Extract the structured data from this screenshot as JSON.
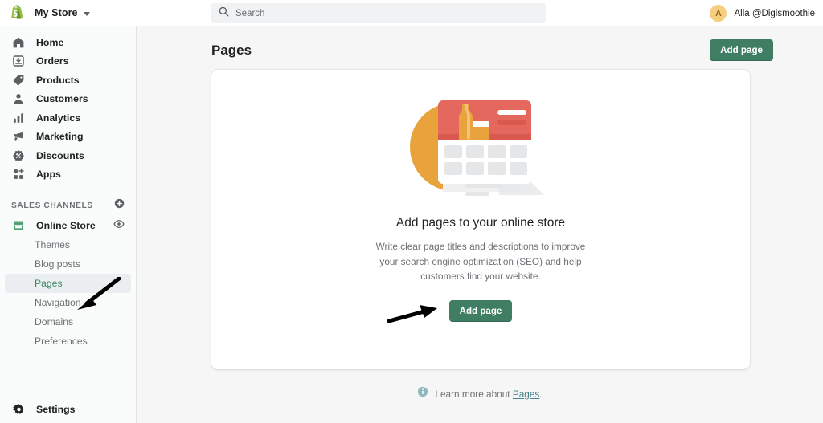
{
  "topbar": {
    "logo_icon": "shopify-bag-icon",
    "store_name": "My Store",
    "store_caret_icon": "chevron-down-icon",
    "search": {
      "icon": "search-icon",
      "placeholder": "Search",
      "value": ""
    },
    "user": {
      "avatar_initial": "A",
      "name": "Alla @Digismoothie",
      "avatar_color": "#f5ce7f"
    }
  },
  "sidebar": {
    "items": [
      {
        "label": "Home",
        "icon": "home-icon"
      },
      {
        "label": "Orders",
        "icon": "orders-inbox-icon"
      },
      {
        "label": "Products",
        "icon": "product-tag-icon"
      },
      {
        "label": "Customers",
        "icon": "customer-person-icon"
      },
      {
        "label": "Analytics",
        "icon": "analytics-bars-icon"
      },
      {
        "label": "Marketing",
        "icon": "marketing-megaphone-icon"
      },
      {
        "label": "Discounts",
        "icon": "discount-badge-icon"
      },
      {
        "label": "Apps",
        "icon": "apps-grid-plus-icon"
      }
    ],
    "sales_channels": {
      "title": "SALES CHANNELS",
      "add_icon": "plus-circle-icon",
      "channel": {
        "label": "Online Store",
        "icon": "storefront-icon",
        "icon_color": "#4a9c6d",
        "view_icon": "eye-icon"
      },
      "sub_items": [
        {
          "label": "Themes",
          "active": false
        },
        {
          "label": "Blog posts",
          "active": false
        },
        {
          "label": "Pages",
          "active": true
        },
        {
          "label": "Navigation",
          "active": false
        },
        {
          "label": "Domains",
          "active": false
        },
        {
          "label": "Preferences",
          "active": false
        }
      ]
    },
    "settings": {
      "label": "Settings",
      "icon": "gear-icon"
    }
  },
  "main": {
    "page_title": "Pages",
    "add_page_button": "Add page",
    "empty_state": {
      "illustration": "pages-empty-state-illustration",
      "title": "Add pages to your online store",
      "body": "Write clear page titles and descriptions to improve your search engine optimization (SEO) and help customers find your website.",
      "cta_label": "Add page"
    },
    "footer": {
      "info_icon": "info-circle-icon",
      "text": "Learn more about",
      "link": "Pages",
      "period": "."
    }
  },
  "annotations": [
    {
      "name": "arrow-pointing-to-pages-nav",
      "direction": "down-left"
    },
    {
      "name": "arrow-pointing-to-add-page-button",
      "direction": "right"
    }
  ],
  "colors": {
    "brand_green": "#3f7e63",
    "active_green": "#3b8a63",
    "page_bg": "#f6f6f7",
    "sidebar_bg": "#fafbfb",
    "card_bg": "#ffffff"
  }
}
